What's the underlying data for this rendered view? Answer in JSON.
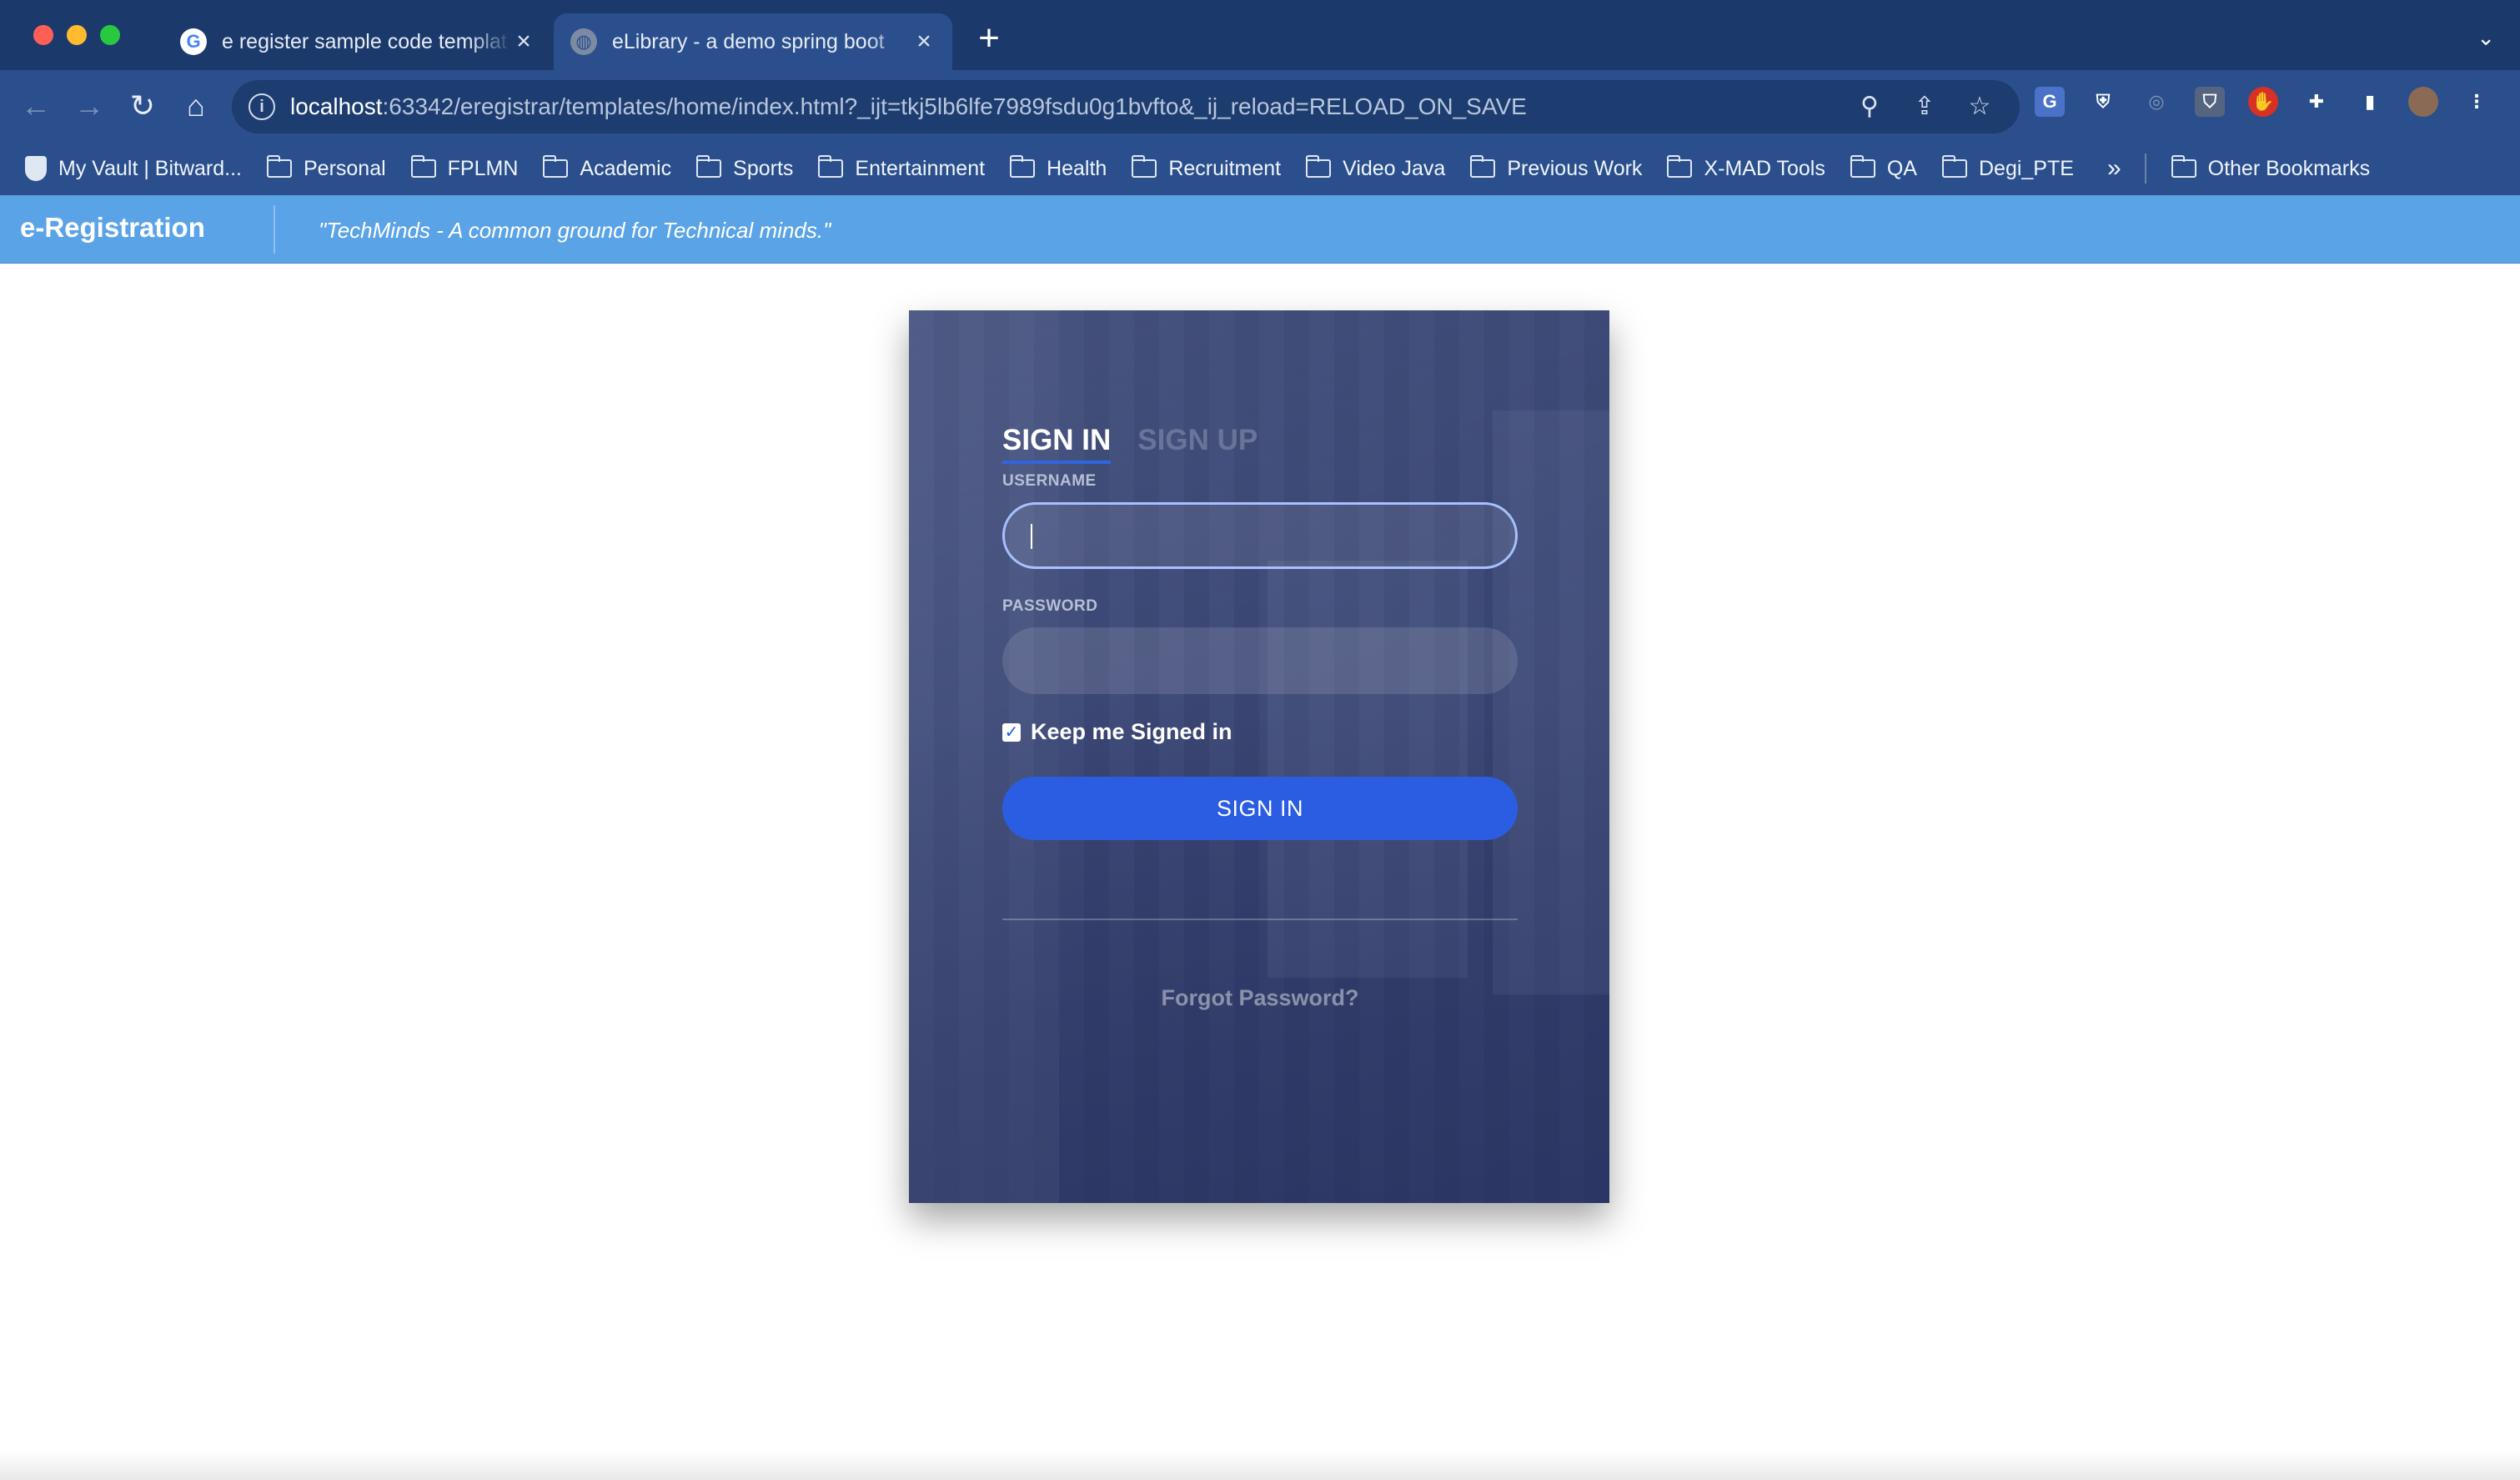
{
  "browser": {
    "tabs": [
      {
        "title": "e register sample code templat",
        "favicon": "google-icon",
        "active": false
      },
      {
        "title": "eLibrary - a demo spring boot",
        "favicon": "globe-icon",
        "active": true
      }
    ],
    "new_tab": "+",
    "address": {
      "host": "localhost",
      "rest": ":63342/eregistrar/templates/home/index.html?_ijt=tkj5lb6lfe7989fsdu0g1bvfto&_ij_reload=RELOAD_ON_SAVE"
    },
    "bookmarks": [
      {
        "label": "My Vault | Bitward...",
        "icon": "bitwarden-icon"
      },
      {
        "label": "Personal",
        "icon": "folder-icon"
      },
      {
        "label": "FPLMN",
        "icon": "folder-icon"
      },
      {
        "label": "Academic",
        "icon": "folder-icon"
      },
      {
        "label": "Sports",
        "icon": "folder-icon"
      },
      {
        "label": "Entertainment",
        "icon": "folder-icon"
      },
      {
        "label": "Health",
        "icon": "folder-icon"
      },
      {
        "label": "Recruitment",
        "icon": "folder-icon"
      },
      {
        "label": "Video Java",
        "icon": "folder-icon"
      },
      {
        "label": "Previous Work",
        "icon": "folder-icon"
      },
      {
        "label": "X-MAD Tools",
        "icon": "folder-icon"
      },
      {
        "label": "QA",
        "icon": "folder-icon"
      },
      {
        "label": "Degi_PTE",
        "icon": "folder-icon"
      }
    ],
    "bookmarks_more": "»",
    "other_bookmarks": "Other Bookmarks"
  },
  "app": {
    "brand": "e-Registration",
    "tagline": "\"TechMinds - A common ground for Technical minds.\""
  },
  "login": {
    "tab_signin": "SIGN IN",
    "tab_signup": "SIGN UP",
    "username_label": "USERNAME",
    "username_value": "",
    "password_label": "PASSWORD",
    "password_value": "",
    "keep_signed_in": "Keep me Signed in",
    "keep_signed_in_checked": true,
    "signin_button": "SIGN IN",
    "forgot_password": "Forgot Password?"
  },
  "colors": {
    "chrome_dark": "#1b3a6b",
    "chrome": "#2a4f8c",
    "header": "#5aa3e6",
    "card": "#34416e",
    "primary_button": "#2b5de3"
  }
}
